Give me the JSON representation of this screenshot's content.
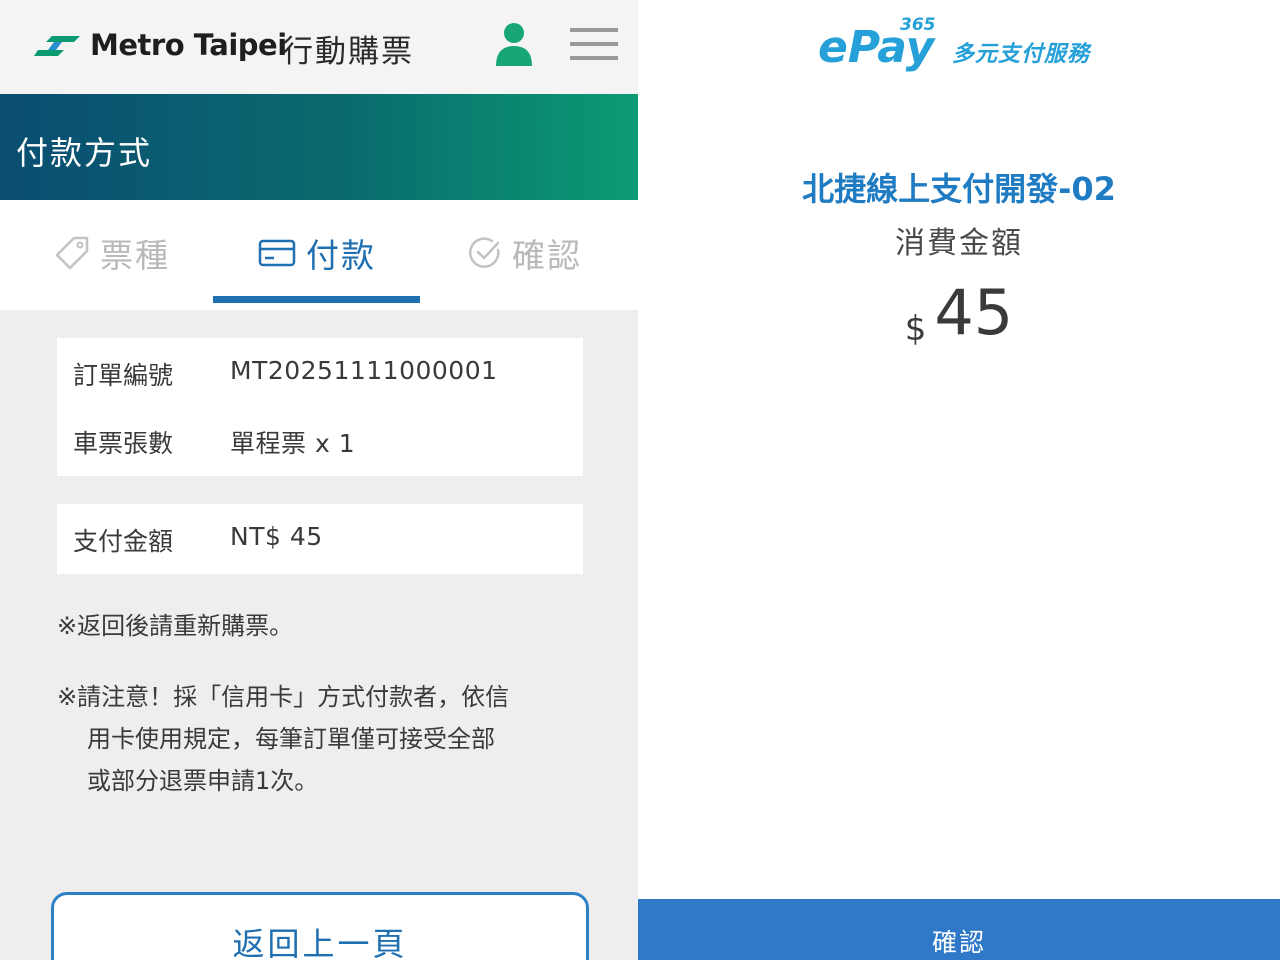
{
  "metro": {
    "brand": "Metro Taipei",
    "app_title": "行動購票",
    "section_title": "付款方式",
    "tabs": [
      {
        "label": "票種",
        "icon": "ticket-icon",
        "state": "inactive"
      },
      {
        "label": "付款",
        "icon": "credit-card-icon",
        "state": "active"
      },
      {
        "label": "確認",
        "icon": "check-circle-icon",
        "state": "inactive"
      }
    ],
    "order": {
      "order_no_label": "訂單編號",
      "order_no": "MT20251111000001",
      "qty_label": "車票張數",
      "qty": "單程票 x 1"
    },
    "payment": {
      "amount_label": "支付金額",
      "amount": "NT$ 45"
    },
    "notes": {
      "note1": "※返回後請重新購票。",
      "note2_l1": "※請注意！採「信用卡」方式付款者，依信",
      "note2_l2": "用卡使用規定，每筆訂單僅可接受全部",
      "note2_l3": "或部分退票申請1次。"
    },
    "back_button": "返回上一頁",
    "colors": {
      "brand_green": "#0b9b73",
      "accent_blue": "#1f6fb1"
    }
  },
  "epay": {
    "logo_text": "ePay",
    "logo_badge": "365",
    "subtitle": "多元支付服務",
    "merchant": "北捷線上支付開發-02",
    "amount_label": "消費金額",
    "currency": "$",
    "amount": "45",
    "confirm_button": "確認",
    "colors": {
      "logo": "#25a0d8",
      "button": "#2f79c8"
    }
  }
}
